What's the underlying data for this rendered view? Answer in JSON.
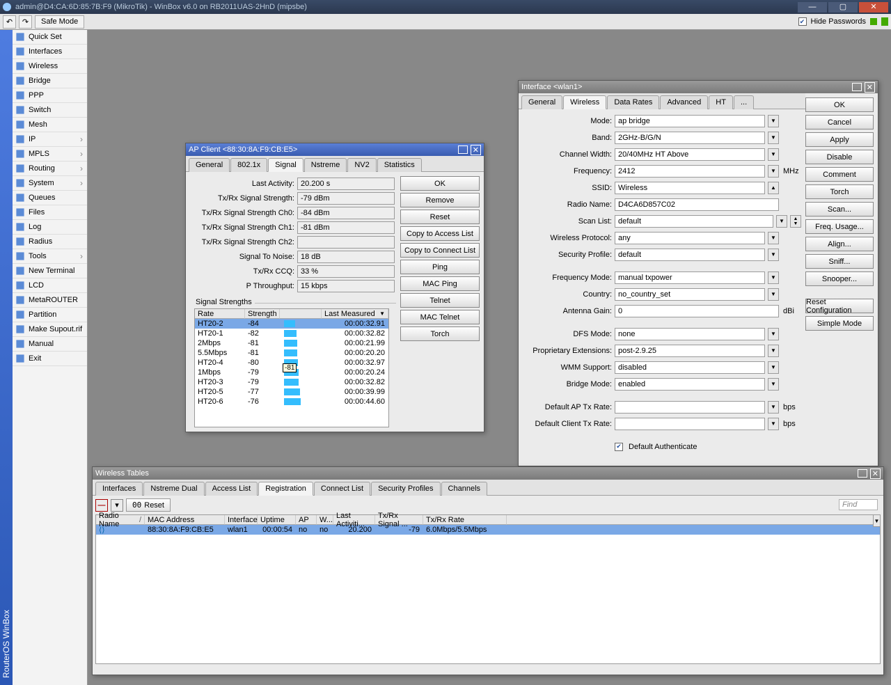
{
  "app": {
    "title": "admin@D4:CA:6D:85:7B:F9 (MikroTik) - WinBox v6.0 on RB2011UAS-2HnD (mipsbe)",
    "safe_mode": "Safe Mode",
    "hide_pw": "Hide Passwords",
    "shelf": "RouterOS WinBox"
  },
  "sidebar": {
    "items": [
      "Quick Set",
      "Interfaces",
      "Wireless",
      "Bridge",
      "PPP",
      "Switch",
      "Mesh",
      "IP",
      "MPLS",
      "Routing",
      "System",
      "Queues",
      "Files",
      "Log",
      "Radius",
      "Tools",
      "New Terminal",
      "LCD",
      "MetaROUTER",
      "Partition",
      "Make Supout.rif",
      "Manual",
      "Exit"
    ],
    "arrows": [
      7,
      8,
      9,
      10,
      15
    ]
  },
  "apclient": {
    "title": "AP Client <88:30:8A:F9:CB:E5>",
    "tabs": [
      "General",
      "802.1x",
      "Signal",
      "Nstreme",
      "NV2",
      "Statistics"
    ],
    "tab_active": 2,
    "rows": [
      {
        "lbl": "Last Activity:",
        "val": "20.200 s"
      },
      {
        "lbl": "Tx/Rx Signal Strength:",
        "val": "-79 dBm"
      },
      {
        "lbl": "Tx/Rx Signal Strength Ch0:",
        "val": "-84 dBm"
      },
      {
        "lbl": "Tx/Rx Signal Strength Ch1:",
        "val": "-81 dBm"
      },
      {
        "lbl": "Tx/Rx Signal Strength Ch2:",
        "val": ""
      },
      {
        "lbl": "Signal To Noise:",
        "val": "18 dB"
      },
      {
        "lbl": "Tx/Rx CCQ:",
        "val": "33 %"
      },
      {
        "lbl": "P Throughput:",
        "val": "15 kbps"
      }
    ],
    "ss_label": "Signal Strengths",
    "ss_head": [
      "Rate",
      "Strength",
      "",
      "Last Measured"
    ],
    "ss_widths": [
      72,
      50,
      60,
      75
    ],
    "ss": [
      {
        "r": "HT20-2",
        "s": "-84",
        "b": 16,
        "t": "00:00:32.91",
        "sel": true
      },
      {
        "r": "HT20-1",
        "s": "-82",
        "b": 18,
        "t": "00:00:32.82"
      },
      {
        "r": "2Mbps",
        "s": "-81",
        "b": 19,
        "t": "00:00:21.99"
      },
      {
        "r": "5.5Mbps",
        "s": "-81",
        "b": 19,
        "t": "00:00:20.20"
      },
      {
        "r": "HT20-4",
        "s": "-80",
        "b": 20,
        "t": "00:00:32.97"
      },
      {
        "r": "1Mbps",
        "s": "-79",
        "b": 21,
        "t": "00:00:20.24"
      },
      {
        "r": "HT20-3",
        "s": "-79",
        "b": 21,
        "t": "00:00:32.82"
      },
      {
        "r": "HT20-5",
        "s": "-77",
        "b": 23,
        "t": "00:00:39.99"
      },
      {
        "r": "HT20-6",
        "s": "-76",
        "b": 24,
        "t": "00:00:44.60"
      }
    ],
    "tip": "-81",
    "btns": [
      "OK",
      "Remove",
      "Reset",
      "Copy to Access List",
      "Copy to Connect List",
      "Ping",
      "MAC Ping",
      "Telnet",
      "MAC Telnet",
      "Torch"
    ]
  },
  "iface": {
    "title": "Interface <wlan1>",
    "tabs": [
      "General",
      "Wireless",
      "Data Rates",
      "Advanced",
      "HT",
      "..."
    ],
    "tab_active": 1,
    "fields": [
      {
        "lbl": "Mode:",
        "val": "ap bridge",
        "dd": true
      },
      {
        "lbl": "Band:",
        "val": "2GHz-B/G/N",
        "dd": true
      },
      {
        "lbl": "Channel Width:",
        "val": "20/40MHz HT Above",
        "dd": true
      },
      {
        "lbl": "Frequency:",
        "val": "2412",
        "dd": true,
        "unit": "MHz"
      },
      {
        "lbl": "SSID:",
        "val": "Wireless",
        "dd": false,
        "up": true
      },
      {
        "lbl": "Radio Name:",
        "val": "D4CA6D857C02",
        "dd": false
      },
      {
        "lbl": "Scan List:",
        "val": "default",
        "dd": true,
        "updown": true
      },
      {
        "lbl": "Wireless Protocol:",
        "val": "any",
        "dd": true
      },
      {
        "lbl": "Security Profile:",
        "val": "default",
        "dd": true
      }
    ],
    "fields2": [
      {
        "lbl": "Frequency Mode:",
        "val": "manual txpower",
        "dd": true
      },
      {
        "lbl": "Country:",
        "val": "no_country_set",
        "dd": true
      },
      {
        "lbl": "Antenna Gain:",
        "val": "0",
        "unit": "dBi"
      }
    ],
    "fields3": [
      {
        "lbl": "DFS Mode:",
        "val": "none",
        "dd": true
      },
      {
        "lbl": "Proprietary Extensions:",
        "val": "post-2.9.25",
        "dd": true
      },
      {
        "lbl": "WMM Support:",
        "val": "disabled",
        "dd": true
      },
      {
        "lbl": "Bridge Mode:",
        "val": "enabled",
        "dd": true
      }
    ],
    "fields4": [
      {
        "lbl": "Default AP Tx Rate:",
        "val": "",
        "dd": false,
        "down": true,
        "unit": "bps"
      },
      {
        "lbl": "Default Client Tx Rate:",
        "val": "",
        "dd": false,
        "down": true,
        "unit": "bps"
      }
    ],
    "auth": "Default Authenticate",
    "btns": [
      "OK",
      "Cancel",
      "Apply",
      "Disable",
      "Comment",
      "Torch",
      "Scan...",
      "Freq. Usage...",
      "Align...",
      "Sniff...",
      "Snooper..."
    ],
    "btns2": [
      "Reset Configuration",
      "Simple Mode"
    ]
  },
  "wtables": {
    "title": "Wireless Tables",
    "tabs": [
      "Interfaces",
      "Nstreme Dual",
      "Access List",
      "Registration",
      "Connect List",
      "Security Profiles",
      "Channels"
    ],
    "tab_active": 3,
    "reset": "Reset",
    "find": "Find",
    "head": [
      "Radio Name",
      "MAC Address",
      "Interface",
      "Uptime",
      "AP",
      "W...",
      "Last Activiti...",
      "Tx/Rx Signal ...",
      "Tx/Rx Rate"
    ],
    "head_w": [
      70,
      115,
      47,
      55,
      30,
      24,
      60,
      69,
      120
    ],
    "row": [
      "",
      "88:30:8A:F9:CB:E5",
      "wlan1",
      "00:00:54",
      "no",
      "no",
      "20.200",
      "-79",
      "6.0Mbps/5.5Mbps"
    ]
  }
}
